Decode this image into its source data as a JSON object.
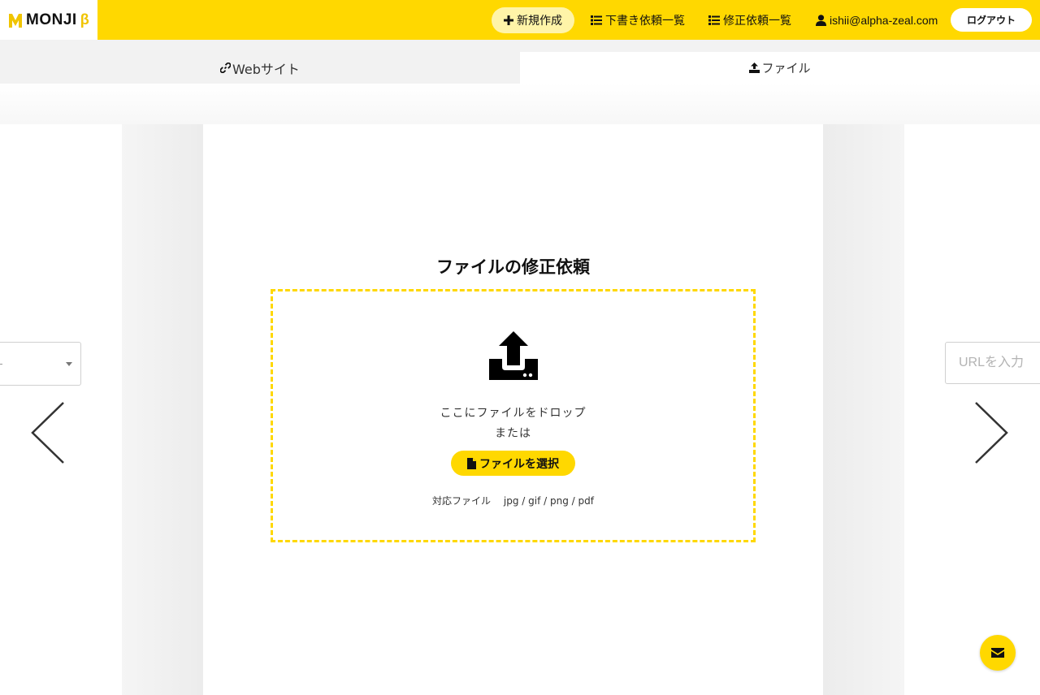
{
  "header": {
    "logo_text": "MONJI",
    "logo_beta": "β",
    "nav": {
      "new": "新規作成",
      "drafts": "下書き依頼一覧",
      "revisions": "修正依頼一覧",
      "user": "ishii@alpha-zeal.com",
      "logout": "ログアウト"
    }
  },
  "tabs": {
    "website": "Webサイト",
    "file": "ファイル",
    "active": "file"
  },
  "right_panel": {
    "url_placeholder": "URLを入力"
  },
  "main": {
    "title": "ファイルの修正依頼",
    "drop_text": "ここにファイルをドロップ",
    "or_text": "または",
    "select_button": "ファイルを選択",
    "formats_label": "対応ファイル",
    "formats": "jpg / gif / png / pdf"
  },
  "colors": {
    "accent": "#ffd800",
    "accent_light": "#fff4a8"
  },
  "icons": [
    "plus-icon",
    "list-icon",
    "user-icon",
    "link-icon",
    "upload-icon",
    "file-icon",
    "chevron-left-icon",
    "chevron-right-icon",
    "envelope-icon"
  ]
}
